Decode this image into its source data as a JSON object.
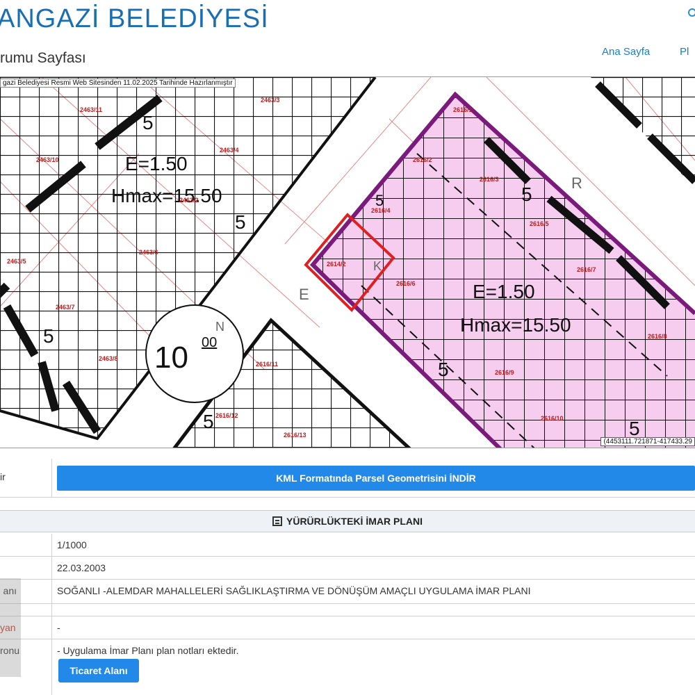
{
  "header": {
    "title": "ANGAZİ BELEDİYESİ",
    "subtitle": "rumu Sayfası",
    "nav": {
      "home": "Ana Sayfa",
      "other": "Pl"
    }
  },
  "map": {
    "caption": "gazi Belediyesi Resmi Web Sitesinden 11.02.2025 Tarihinde Hazırlanmıştır",
    "coords": "(4453111.721871-417433.29",
    "zone_left": {
      "e": "E=1.50",
      "hmax": "Hmax=15.50"
    },
    "zone_right": {
      "e": "E=1.50",
      "hmax": "Hmax=15.50"
    },
    "road_width": "10",
    "road_width_sup": "00",
    "setback": "5",
    "street_letters": [
      "E",
      "K",
      "N",
      "R"
    ],
    "parcels": [
      "2463/11",
      "2463/3",
      "2463/10",
      "2463/4",
      "2463/2",
      "2463/5",
      "2463/6",
      "2463/7",
      "2463/8",
      "2614/2",
      "2616/1",
      "2616/2",
      "2616/3",
      "2616/4",
      "2616/5",
      "2616/6",
      "2616/7",
      "2616/8",
      "2616/9",
      "2616/10",
      "2616/11",
      "2616/12",
      "2616/13"
    ],
    "colors": {
      "highlight_fill": "#f6cdef",
      "highlight_border": "#7a1a7a",
      "selection": "#e02020",
      "parcel_text": "#c01a1a",
      "grid": "#111111"
    }
  },
  "download": {
    "label_fragment": "ir",
    "button": "KML Formatında Parsel Geometrisini İNDİR"
  },
  "plan": {
    "section_title": "YÜRÜRLÜKTEKİ İMAR PLANI",
    "rows": [
      {
        "label": "",
        "value": "1/1000"
      },
      {
        "label": "",
        "value": "22.03.2003"
      },
      {
        "label": "anı",
        "value": "SOĞANLI -ALEMDAR MAHALLELERİ SAĞLIKLAŞTIRMA VE DÖNÜŞÜM AMAÇLI UYGULAMA İMAR PLANI"
      },
      {
        "label": "yan",
        "value": "-"
      },
      {
        "label": "ronu",
        "value": "- Uygulama İmar Planı plan notları ektedir."
      }
    ],
    "tag_button": "Ticaret Alanı"
  }
}
